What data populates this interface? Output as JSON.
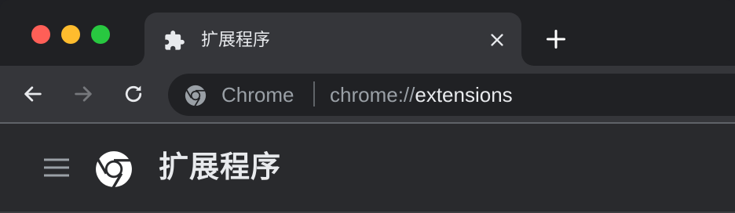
{
  "window": {
    "traffic_lights": {
      "close": "#ff5f57",
      "minimize": "#febc2e",
      "zoom": "#28c840"
    }
  },
  "tab": {
    "icon": "puzzle-piece-icon",
    "title": "扩展程序",
    "close_icon": "close-icon"
  },
  "new_tab": {
    "icon": "plus-icon"
  },
  "toolbar": {
    "back_icon": "arrow-left-icon",
    "forward_icon": "arrow-right-icon",
    "reload_icon": "reload-icon"
  },
  "omnibox": {
    "site_icon": "chrome-icon",
    "chip_label": "Chrome",
    "url_scheme": "chrome://",
    "url_host": "extensions"
  },
  "page": {
    "menu_icon": "hamburger-menu-icon",
    "logo_icon": "chrome-logo-icon",
    "title": "扩展程序"
  },
  "colors": {
    "tab_active": "#35363a",
    "frame": "#202124",
    "page_bg": "#292a2d",
    "text_primary": "#e8eaed",
    "text_secondary": "#9aa0a6"
  }
}
